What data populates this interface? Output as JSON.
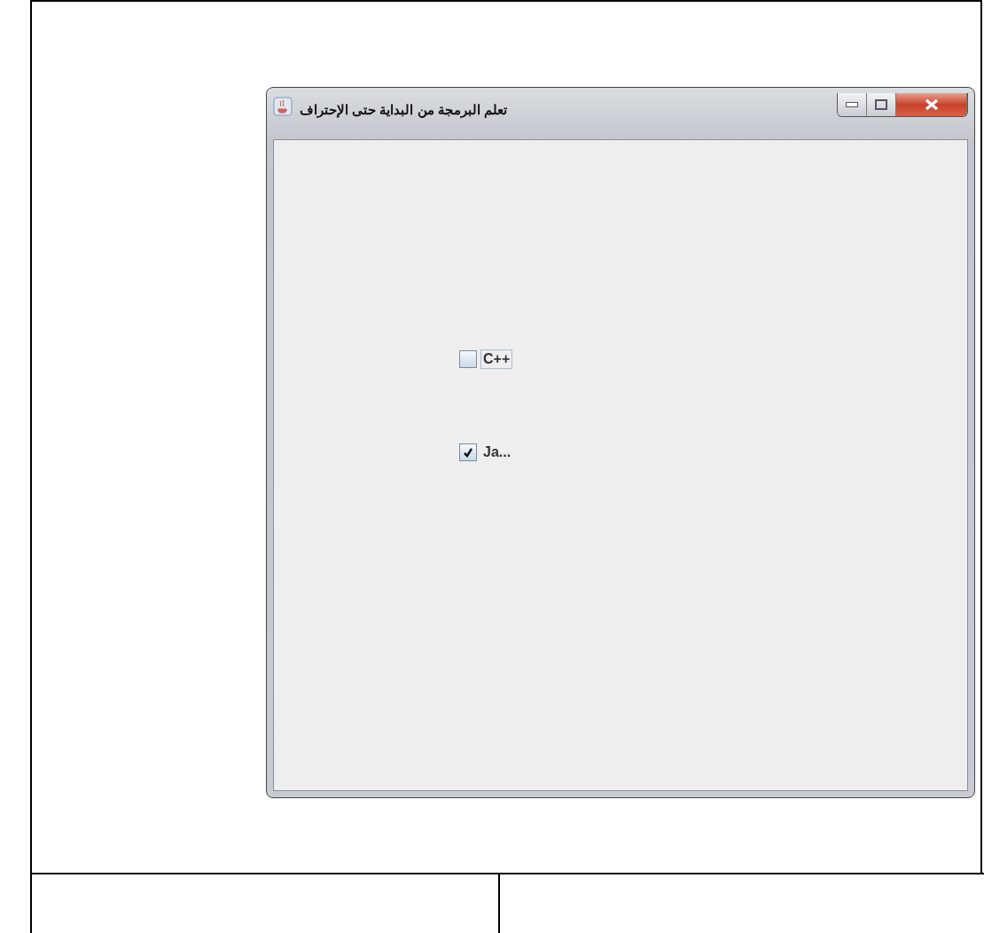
{
  "window": {
    "title": "تعلم البرمجة من البداية حتى الإحتراف"
  },
  "checkboxes": [
    {
      "label": "C++",
      "checked": false,
      "focused": true
    },
    {
      "label": "Ja...",
      "checked": true,
      "focused": false
    }
  ]
}
